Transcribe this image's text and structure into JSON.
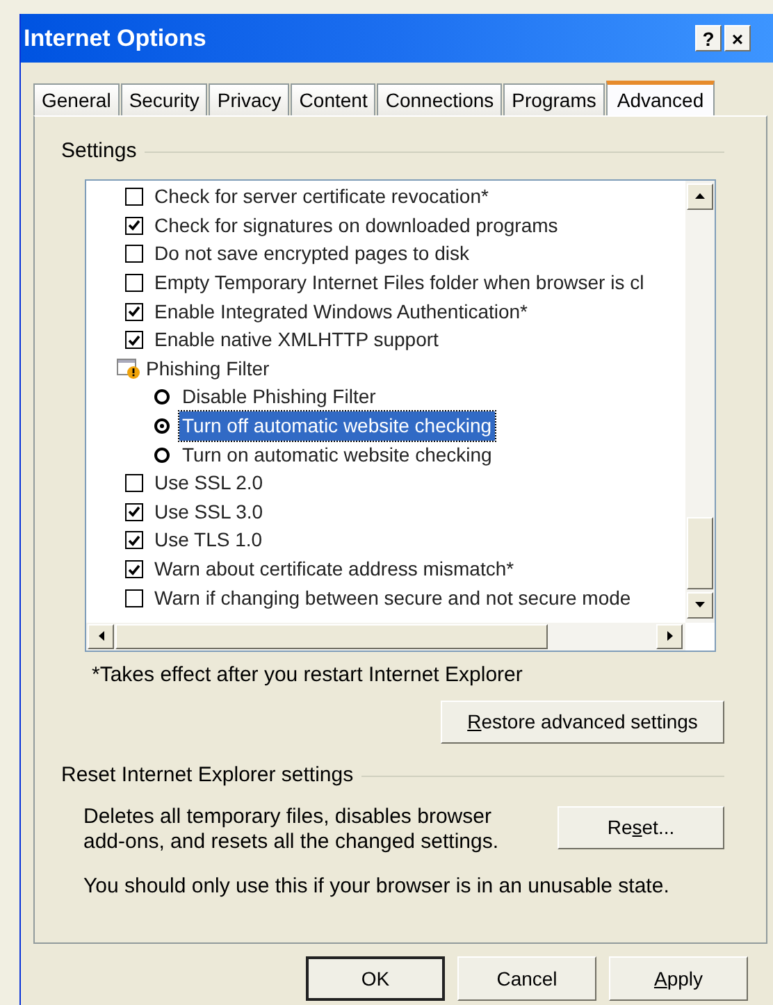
{
  "window": {
    "title": "Internet Options",
    "buttons": [
      "?",
      "×"
    ]
  },
  "tabs": [
    {
      "label": "General",
      "selected": false
    },
    {
      "label": "Security",
      "selected": false
    },
    {
      "label": "Privacy",
      "selected": false
    },
    {
      "label": "Content",
      "selected": false
    },
    {
      "label": "Connections",
      "selected": false
    },
    {
      "label": "Programs",
      "selected": false
    },
    {
      "label": "Advanced",
      "selected": true
    }
  ],
  "settings": {
    "title": "Settings",
    "items": [
      {
        "kind": "checkbox",
        "label": "Check for server certificate revocation*",
        "checked": false
      },
      {
        "kind": "checkbox",
        "label": "Check for signatures on downloaded programs",
        "checked": true
      },
      {
        "kind": "checkbox",
        "label": "Do not save encrypted pages to disk",
        "checked": false
      },
      {
        "kind": "checkbox",
        "label": "Empty Temporary Internet Files folder when browser is cl",
        "checked": false
      },
      {
        "kind": "checkbox",
        "label": "Enable Integrated Windows Authentication*",
        "checked": true
      },
      {
        "kind": "checkbox",
        "label": "Enable native XMLHTTP support",
        "checked": true
      },
      {
        "kind": "group",
        "label": "Phishing Filter",
        "children": [
          {
            "kind": "radio",
            "label": "Disable Phishing Filter",
            "selected": false
          },
          {
            "kind": "radio",
            "label": "Turn off automatic website checking",
            "selected": true
          },
          {
            "kind": "radio",
            "label": "Turn on automatic website checking",
            "selected": false
          }
        ]
      },
      {
        "kind": "checkbox",
        "label": "Use SSL 2.0",
        "checked": false
      },
      {
        "kind": "checkbox",
        "label": "Use SSL 3.0",
        "checked": true
      },
      {
        "kind": "checkbox",
        "label": "Use TLS 1.0",
        "checked": true
      },
      {
        "kind": "checkbox",
        "label": "Warn about certificate address mismatch*",
        "checked": true
      },
      {
        "kind": "checkbox",
        "label": "Warn if changing between secure and not secure mode",
        "checked": false
      }
    ],
    "note": "*Takes effect after you restart Internet Explorer",
    "restore_button": {
      "key": "R",
      "post": "estore advanced settings"
    }
  },
  "reset": {
    "title": "Reset Internet Explorer settings",
    "description": "Deletes all temporary files, disables browser add-ons, and resets all the changed settings.",
    "button": {
      "pre": "Re",
      "key": "s",
      "post": "et..."
    },
    "warning": "You should only use this if your browser is in an unusable state."
  },
  "buttons": [
    {
      "pre": "OK",
      "default": true
    },
    {
      "pre": "Cancel",
      "default": false
    },
    {
      "key": "A",
      "post": "pply",
      "default": false
    }
  ]
}
